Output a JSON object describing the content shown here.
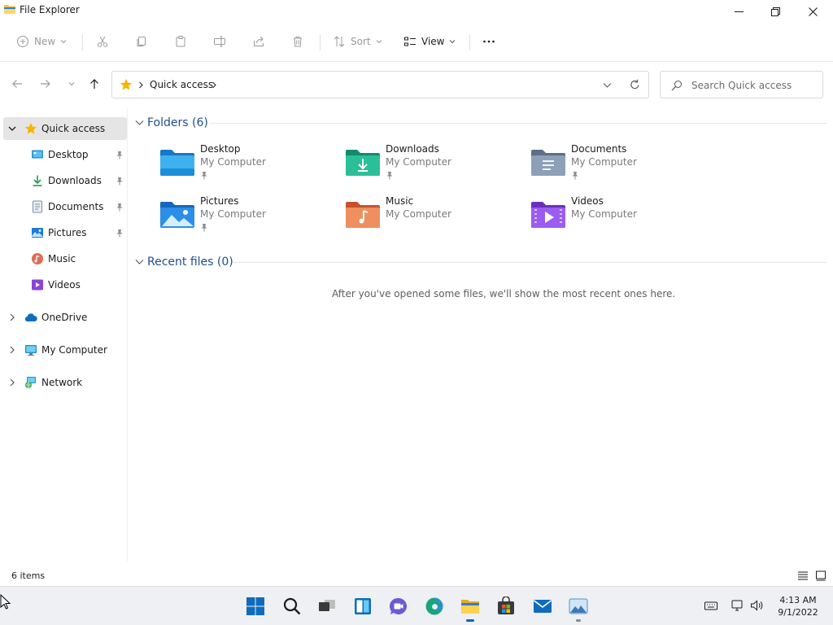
{
  "window": {
    "title": "File Explorer"
  },
  "command_bar": {
    "new_label": "New",
    "sort_label": "Sort",
    "view_label": "View"
  },
  "address": {
    "breadcrumb": "Quick access",
    "search_placeholder": "Search Quick access"
  },
  "nav_pane": {
    "items": [
      {
        "label": "Quick access",
        "icon": "star-icon"
      },
      {
        "label": "Desktop",
        "icon": "desktop-icon"
      },
      {
        "label": "Downloads",
        "icon": "download-icon"
      },
      {
        "label": "Documents",
        "icon": "document-icon"
      },
      {
        "label": "Pictures",
        "icon": "picture-icon"
      },
      {
        "label": "Music",
        "icon": "music-icon"
      },
      {
        "label": "Videos",
        "icon": "video-icon"
      },
      {
        "label": "OneDrive",
        "icon": "cloud-icon"
      },
      {
        "label": "My Computer",
        "icon": "computer-icon"
      },
      {
        "label": "Network",
        "icon": "network-icon"
      }
    ]
  },
  "folders": {
    "header": "Folders (6)",
    "items": [
      {
        "name": "Desktop",
        "location": "My Computer",
        "pinned": true,
        "icon": "desktop-folder-icon"
      },
      {
        "name": "Downloads",
        "location": "My Computer",
        "pinned": true,
        "icon": "downloads-folder-icon"
      },
      {
        "name": "Documents",
        "location": "My Computer",
        "pinned": true,
        "icon": "documents-folder-icon"
      },
      {
        "name": "Pictures",
        "location": "My Computer",
        "pinned": true,
        "icon": "pictures-folder-icon"
      },
      {
        "name": "Music",
        "location": "My Computer",
        "pinned": false,
        "icon": "music-folder-icon"
      },
      {
        "name": "Videos",
        "location": "My Computer",
        "pinned": false,
        "icon": "videos-folder-icon"
      }
    ]
  },
  "recent": {
    "header": "Recent files (0)",
    "empty_message": "After you've opened some files, we'll show the most recent ones here."
  },
  "status": {
    "item_count": "6 items"
  },
  "taskbar": {
    "apps": [
      "start-icon",
      "search-icon",
      "task-view-icon",
      "widgets-icon",
      "chat-icon",
      "edge-icon",
      "file-explorer-icon",
      "store-icon",
      "mail-icon",
      "photos-icon"
    ],
    "time": "4:13 AM",
    "date": "9/1/2022"
  },
  "colors": {
    "accent": "#0067c0",
    "group_header": "#1f4e8c",
    "selection": "#e5e5e5"
  }
}
